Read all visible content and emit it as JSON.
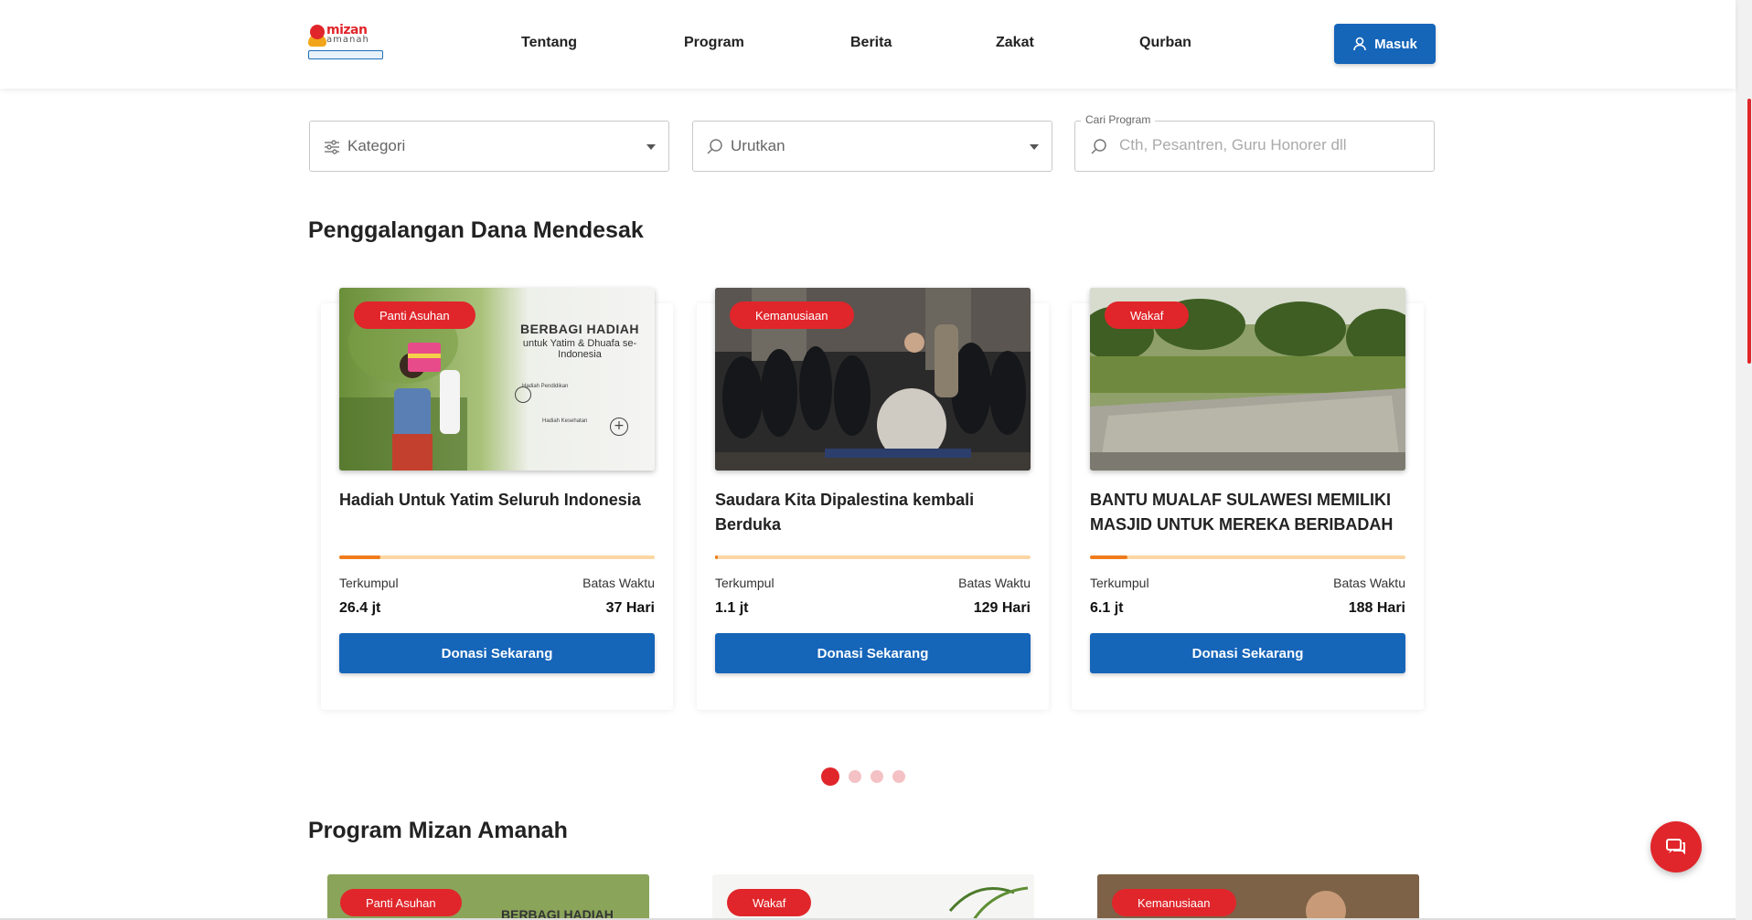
{
  "brand": {
    "logo_text": "mizan",
    "logo_sub": "amanah",
    "logo_tag": "Lembaga Amil Zakat Nasional",
    "accent": "#e0262b",
    "primary": "#1565b9"
  },
  "nav": {
    "items": [
      "Tentang",
      "Program",
      "Berita",
      "Zakat",
      "Qurban"
    ],
    "login_label": "Masuk"
  },
  "filters": {
    "category_placeholder": "Kategori",
    "sort_placeholder": "Urutkan",
    "search_legend": "Cari Program",
    "search_placeholder": "Cth, Pesantren, Guru Honorer dll"
  },
  "urgent": {
    "title": "Penggalangan Dana Mendesak",
    "cards": [
      {
        "badge": "Panti Asuhan",
        "title": "Hadiah Untuk Yatim Seluruh Indonesia",
        "collected_label": "Terkumpul",
        "collected": "26.4 jt",
        "deadline_label": "Batas Waktu",
        "deadline": "37 Hari",
        "progress": 0.13,
        "button": "Donasi Sekarang",
        "image_text": {
          "headline": "BERBAGI HADIAH",
          "sub": "untuk Yatim & Dhuafa se-Indonesia",
          "item1": "Hadiah Pendidikan",
          "item2": "Hadiah Kesehatan"
        }
      },
      {
        "badge": "Kemanusiaan",
        "title": "Saudara Kita Dipalestina kembali Berduka",
        "collected_label": "Terkumpul",
        "collected": "1.1 jt",
        "deadline_label": "Batas Waktu",
        "deadline": "129 Hari",
        "progress": 0.01,
        "button": "Donasi Sekarang"
      },
      {
        "badge": "Wakaf",
        "title": "BANTU MUALAF SULAWESI MEMILIKI MASJID UNTUK MEREKA BERIBADAH",
        "collected_label": "Terkumpul",
        "collected": "6.1 jt",
        "deadline_label": "Batas Waktu",
        "deadline": "188 Hari",
        "progress": 0.12,
        "button": "Donasi Sekarang"
      }
    ],
    "pages": 4,
    "active_page": 1
  },
  "programs": {
    "title": "Program Mizan Amanah",
    "cards": [
      {
        "badge": "Panti Asuhan",
        "image_text": "BERBAGI HADIAH"
      },
      {
        "badge": "Wakaf"
      },
      {
        "badge": "Kemanusiaan"
      }
    ]
  }
}
